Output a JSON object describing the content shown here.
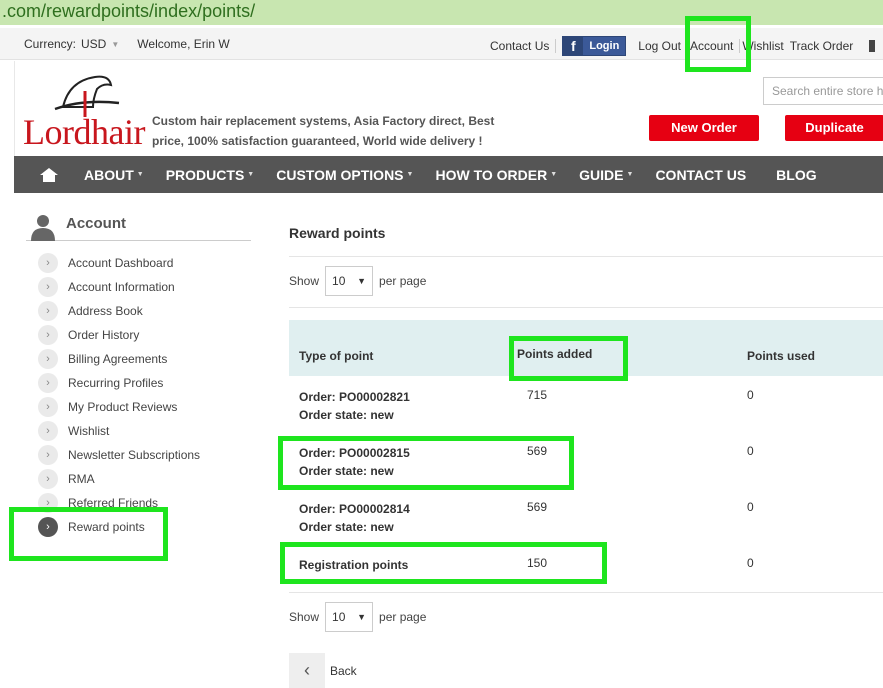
{
  "browser": {
    "url_path": ".com/rewardpoints/index/points/"
  },
  "topbar": {
    "currency_label": "Currency:",
    "currency_value": "USD",
    "welcome": "Welcome, Erin W",
    "links": {
      "contact": "Contact Us",
      "fb_login": "Login",
      "logout": "Log Out",
      "account": "Account",
      "wishlist": "Wishlist",
      "track": "Track Order"
    }
  },
  "header": {
    "logo_text": "Lordhair",
    "tagline": "Custom hair replacement systems, Asia Factory direct, Best price, 100% satisfaction guaranteed, World wide delivery !",
    "search_placeholder": "Search entire store h",
    "btn_new_order": "New Order",
    "btn_duplicate": "Duplicate"
  },
  "nav": {
    "items": [
      {
        "label": "ABOUT",
        "caret": true
      },
      {
        "label": "PRODUCTS",
        "caret": true
      },
      {
        "label": "CUSTOM OPTIONS",
        "caret": true
      },
      {
        "label": "HOW TO ORDER",
        "caret": true
      },
      {
        "label": "GUIDE",
        "caret": true
      },
      {
        "label": "CONTACT US",
        "caret": false
      },
      {
        "label": "BLOG",
        "caret": false
      }
    ]
  },
  "sidebar": {
    "title": "Account",
    "items": [
      "Account Dashboard",
      "Account Information",
      "Address Book",
      "Order History",
      "Billing Agreements",
      "Recurring Profiles",
      "My Product Reviews",
      "Wishlist",
      "Newsletter Subscriptions",
      "RMA",
      "Referred Friends",
      "Reward points"
    ],
    "active": "Reward points"
  },
  "main": {
    "title": "Reward points",
    "pager": {
      "show": "Show",
      "value": "10",
      "per_page": "per page"
    },
    "columns": [
      "Type of point",
      "Points added",
      "Points used"
    ],
    "rows": [
      {
        "type1": "Order: PO00002821",
        "type2": "Order state: new",
        "added": "715",
        "used": "0"
      },
      {
        "type1": "Order: PO00002815",
        "type2": "Order state: new",
        "added": "569",
        "used": "0"
      },
      {
        "type1": "Order: PO00002814",
        "type2": "Order state: new",
        "added": "569",
        "used": "0"
      },
      {
        "type1": "Registration points",
        "type2": "",
        "added": "150",
        "used": "0"
      }
    ],
    "back": "Back"
  },
  "colors": {
    "highlight": "#1ee51e",
    "brand_red": "#e60012",
    "nav_bg": "#555555",
    "table_head": "#e0eff0"
  }
}
